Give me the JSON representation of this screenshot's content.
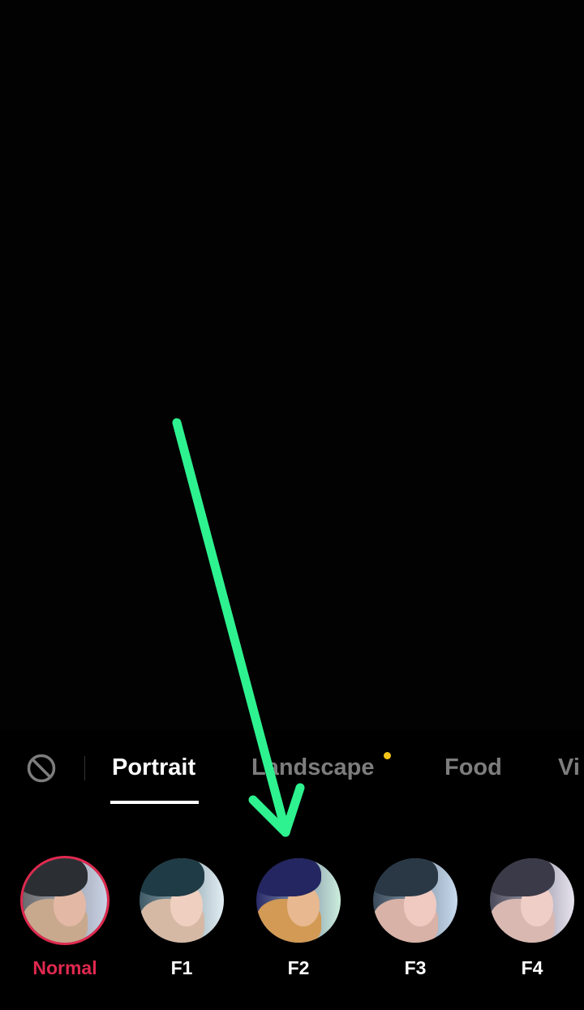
{
  "colors": {
    "accent": "#e0294f",
    "annotation": "#2ef28f",
    "new_dot": "#f5c518",
    "inactive_tab": "#7d7d7d"
  },
  "tabs": {
    "none_icon": "prohibited-icon",
    "items": [
      {
        "label": "Portrait",
        "active": true
      },
      {
        "label": "Landscape",
        "active": false,
        "new_indicator": true
      },
      {
        "label": "Food",
        "active": false
      },
      {
        "label": "Vi",
        "active": false
      }
    ]
  },
  "filters": [
    {
      "label": "Normal",
      "selected": true
    },
    {
      "label": "F1",
      "selected": false
    },
    {
      "label": "F2",
      "selected": false
    },
    {
      "label": "F3",
      "selected": false
    },
    {
      "label": "F4",
      "selected": false
    }
  ]
}
